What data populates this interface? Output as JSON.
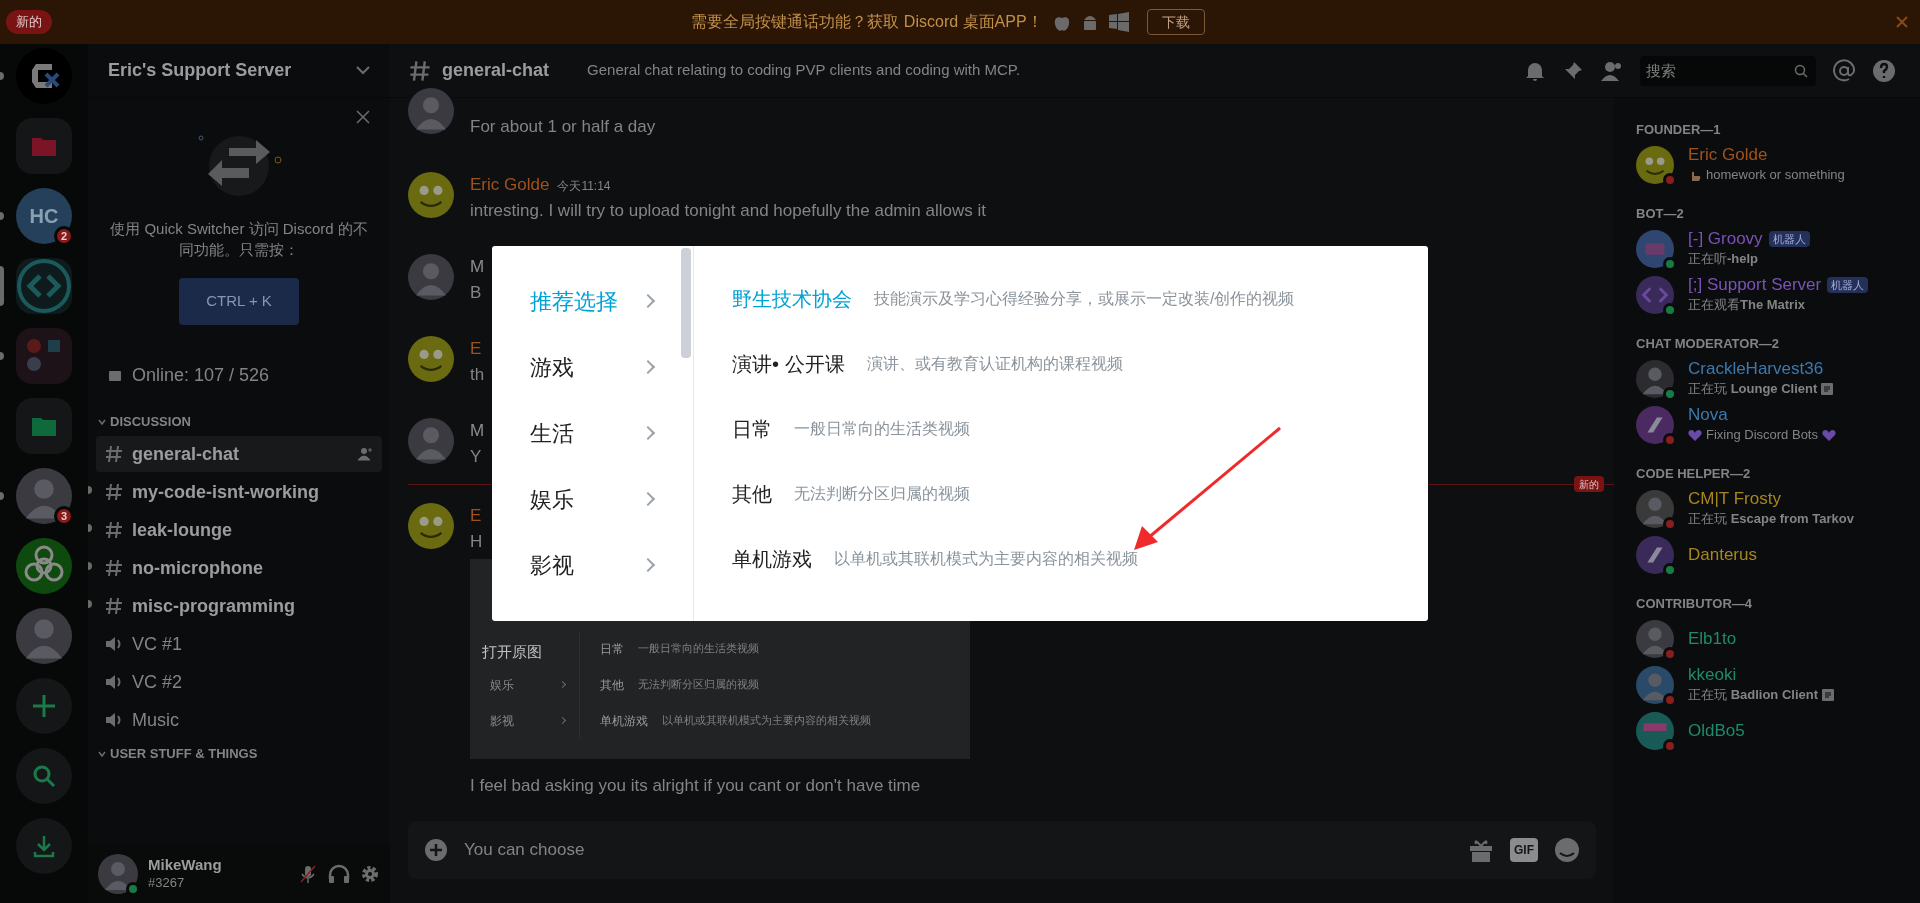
{
  "banner": {
    "badge": "新的",
    "text": "需要全局按键通话功能？获取 Discord 桌面APP！",
    "button": "下载"
  },
  "servers": [
    {
      "kind": "logo",
      "unread": true,
      "selected": false
    },
    {
      "kind": "folder",
      "color": "#7a1426",
      "unread": false,
      "selected": false
    },
    {
      "kind": "initials",
      "label": "HC",
      "badge": "2",
      "unread": true,
      "selected": false
    },
    {
      "kind": "code",
      "unread": false,
      "selected": true
    },
    {
      "kind": "group",
      "unread": true,
      "selected": false
    },
    {
      "kind": "folder",
      "color": "#0e6a3a",
      "unread": false,
      "selected": false
    },
    {
      "kind": "avatar",
      "badge": "3",
      "unread": true,
      "selected": false
    },
    {
      "kind": "hazard",
      "unread": false,
      "selected": false
    },
    {
      "kind": "avatar",
      "unread": false,
      "selected": false
    },
    {
      "kind": "add",
      "unread": false,
      "selected": false
    },
    {
      "kind": "explore",
      "unread": false,
      "selected": false
    },
    {
      "kind": "download",
      "unread": false,
      "selected": false
    }
  ],
  "sidebar": {
    "server_name": "Eric's Support Server",
    "quick_switcher": {
      "text": "使用 Quick Switcher 访问 Discord 的不同功能。只需按：",
      "button": "CTRL + K"
    },
    "online": "Online: 107 / 526",
    "categories": [
      {
        "name": "DISCUSSION",
        "expanded": true,
        "channels": [
          {
            "kind": "text",
            "name": "general-chat",
            "selected": true,
            "unread": false
          },
          {
            "kind": "text",
            "name": "my-code-isnt-working",
            "selected": false,
            "unread": true
          },
          {
            "kind": "text",
            "name": "leak-lounge",
            "selected": false,
            "unread": true
          },
          {
            "kind": "text",
            "name": "no-microphone",
            "selected": false,
            "unread": true
          },
          {
            "kind": "text",
            "name": "misc-programming",
            "selected": false,
            "unread": true
          },
          {
            "kind": "voice",
            "name": "VC #1",
            "selected": false,
            "unread": false
          },
          {
            "kind": "voice",
            "name": "VC #2",
            "selected": false,
            "unread": false
          },
          {
            "kind": "voice",
            "name": "Music",
            "selected": false,
            "unread": false
          }
        ]
      },
      {
        "name": "USER STUFF & THINGS",
        "expanded": true
      }
    ]
  },
  "user": {
    "name": "MikeWang",
    "tag": "#3267",
    "online": true,
    "mic_muted": true
  },
  "channel_header": {
    "name": "general-chat",
    "topic": "General chat relating to coding PVP clients and coding with MCP.",
    "search": {
      "placeholder": "搜索"
    }
  },
  "messages": [
    {
      "kind": "message",
      "text": "For about 1 or half a day"
    },
    {
      "kind": "message",
      "author": "Eric Golde",
      "color": "#a0521c",
      "time": "今天11:14",
      "text": "intresting. I will try to upload tonight and hopefully the admin allows it"
    },
    {
      "kind": "message",
      "author": "M",
      "color": "#8a8c8e",
      "text": "B"
    },
    {
      "kind": "message",
      "author": "E",
      "color": "#a0521c",
      "text": "th"
    },
    {
      "kind": "message",
      "author": "M",
      "color": "#8a8c8e",
      "text": "Y"
    },
    {
      "kind": "divider",
      "label": "新的"
    },
    {
      "kind": "message",
      "author": "E",
      "color": "#a0521c",
      "text": "H",
      "attachment": {
        "link": "打开原图",
        "rows": [
          {
            "title": "日常",
            "description": "一般日常向的生活类视频"
          },
          {
            "menu": "娱乐",
            "title": "其他",
            "description": "无法判断分区归属的视频"
          },
          {
            "menu": "影视",
            "title": "单机游戏",
            "description": "以单机或其联机模式为主要内容的相关视频"
          }
        ]
      }
    },
    {
      "kind": "continuation",
      "text": "I feel bad asking you its alright if you cant or don't have time"
    }
  ],
  "composer": {
    "value": "You can choose",
    "gif_label": "GIF"
  },
  "image_viewer": {
    "menu": [
      {
        "label": "推荐选择",
        "selected": true
      },
      {
        "label": "游戏",
        "selected": false
      },
      {
        "label": "生活",
        "selected": false
      },
      {
        "label": "娱乐",
        "selected": false
      },
      {
        "label": "影视",
        "selected": false
      }
    ],
    "entries": [
      {
        "title": "野生技术协会",
        "description": "技能演示及学习心得经验分享，或展示一定改装/创作的视频",
        "selected": true
      },
      {
        "title": "演讲• 公开课",
        "description": "演讲、或有教育认证机构的课程视频",
        "selected": false
      },
      {
        "title": "日常",
        "description": "一般日常向的生活类视频",
        "selected": false
      },
      {
        "title": "其他",
        "description": "无法判断分区归属的视频",
        "selected": false
      },
      {
        "title": "单机游戏",
        "description": "以单机或其联机模式为主要内容的相关视频",
        "selected": false
      }
    ]
  },
  "member_groups": [
    {
      "role": "FOUNDER—1",
      "members": [
        {
          "kind": "hand-status",
          "name": "Eric Golde",
          "color": "#a0521c",
          "dnd": true,
          "activity": "homework or something"
        }
      ]
    },
    {
      "role": "BOT—2",
      "members": [
        {
          "kind": "plain",
          "name": "[-] Groovy",
          "color": "#7a52b8",
          "dnd": false,
          "tag": "机器人",
          "activity": "正在听**-help**"
        },
        {
          "kind": "plain",
          "name": "[;] Support Server",
          "color": "#7a52b8",
          "dnd": false,
          "tag": "机器人",
          "activity": "正在观看**The Matrix**"
        }
      ]
    },
    {
      "role": "CHAT MODERATOR—2",
      "members": [
        {
          "kind": "rich-presence",
          "name": "CrackleHarvest36",
          "color": "#3a7ab0",
          "dnd": false,
          "activity": "正在玩 **Lounge Client**"
        },
        {
          "kind": "heart-status",
          "name": "Nova",
          "color": "#3a7ab0",
          "dnd": true,
          "activity": "Fixing Discord Bots"
        }
      ]
    },
    {
      "role": "CODE HELPER—2",
      "members": [
        {
          "kind": "plain",
          "name": "CM|T Frosty",
          "color": "#a8861e",
          "dnd": true,
          "activity": "正在玩 **Escape from Tarkov**"
        },
        {
          "kind": "plain",
          "name": "Danterus",
          "color": "#a8861e",
          "dnd": false
        }
      ]
    },
    {
      "role": "CONTRIBUTOR—4",
      "members": [
        {
          "kind": "plain",
          "name": "Elb1to",
          "color": "#1f8a6c",
          "dnd": true
        },
        {
          "kind": "rich-presence",
          "name": "kkeoki",
          "color": "#1f8a6c",
          "dnd": true,
          "activity": "正在玩 **Badlion Client**"
        },
        {
          "kind": "plain",
          "name": "OldBo5",
          "color": "#1f8a6c",
          "dnd": true
        }
      ]
    }
  ]
}
